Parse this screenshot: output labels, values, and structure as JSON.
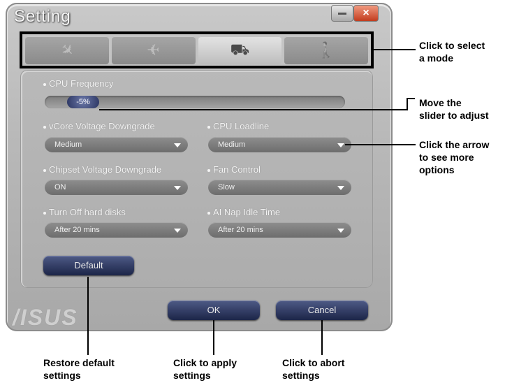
{
  "window": {
    "title": "Setting",
    "close_glyph": "×"
  },
  "tabs": [
    {
      "icon": "satellite-icon",
      "glyph": "✈"
    },
    {
      "icon": "airplane-icon",
      "glyph": "✈"
    },
    {
      "icon": "car-icon",
      "glyph": "⛟"
    },
    {
      "icon": "walking-icon",
      "glyph": "🚶"
    }
  ],
  "settings": {
    "cpu_frequency": {
      "label": "CPU Frequency",
      "value": "-5%"
    },
    "vcore": {
      "label": "vCore Voltage Downgrade",
      "value": "Medium"
    },
    "cpu_loadline": {
      "label": "CPU Loadline",
      "value": "Medium"
    },
    "chipset": {
      "label": "Chipset Voltage Downgrade",
      "value": "ON"
    },
    "fan": {
      "label": "Fan Control",
      "value": "Slow"
    },
    "hard_disks": {
      "label": "Turn Off hard disks",
      "value": "After 20 mins"
    },
    "ai_nap": {
      "label": "AI Nap Idle Time",
      "value": "After 20 mins"
    }
  },
  "buttons": {
    "default": "Default",
    "ok": "OK",
    "cancel": "Cancel"
  },
  "brand": "/ISUS",
  "callouts": {
    "select_mode": [
      "Click to select",
      "a mode"
    ],
    "slider": [
      "Move the",
      "slider to adjust"
    ],
    "arrow": [
      "Click the arrow",
      "to see more",
      "options"
    ],
    "restore": [
      "Restore default",
      "settings"
    ],
    "apply": [
      "Click to apply",
      "settings"
    ],
    "abort": [
      "Click to abort",
      "settings"
    ]
  }
}
